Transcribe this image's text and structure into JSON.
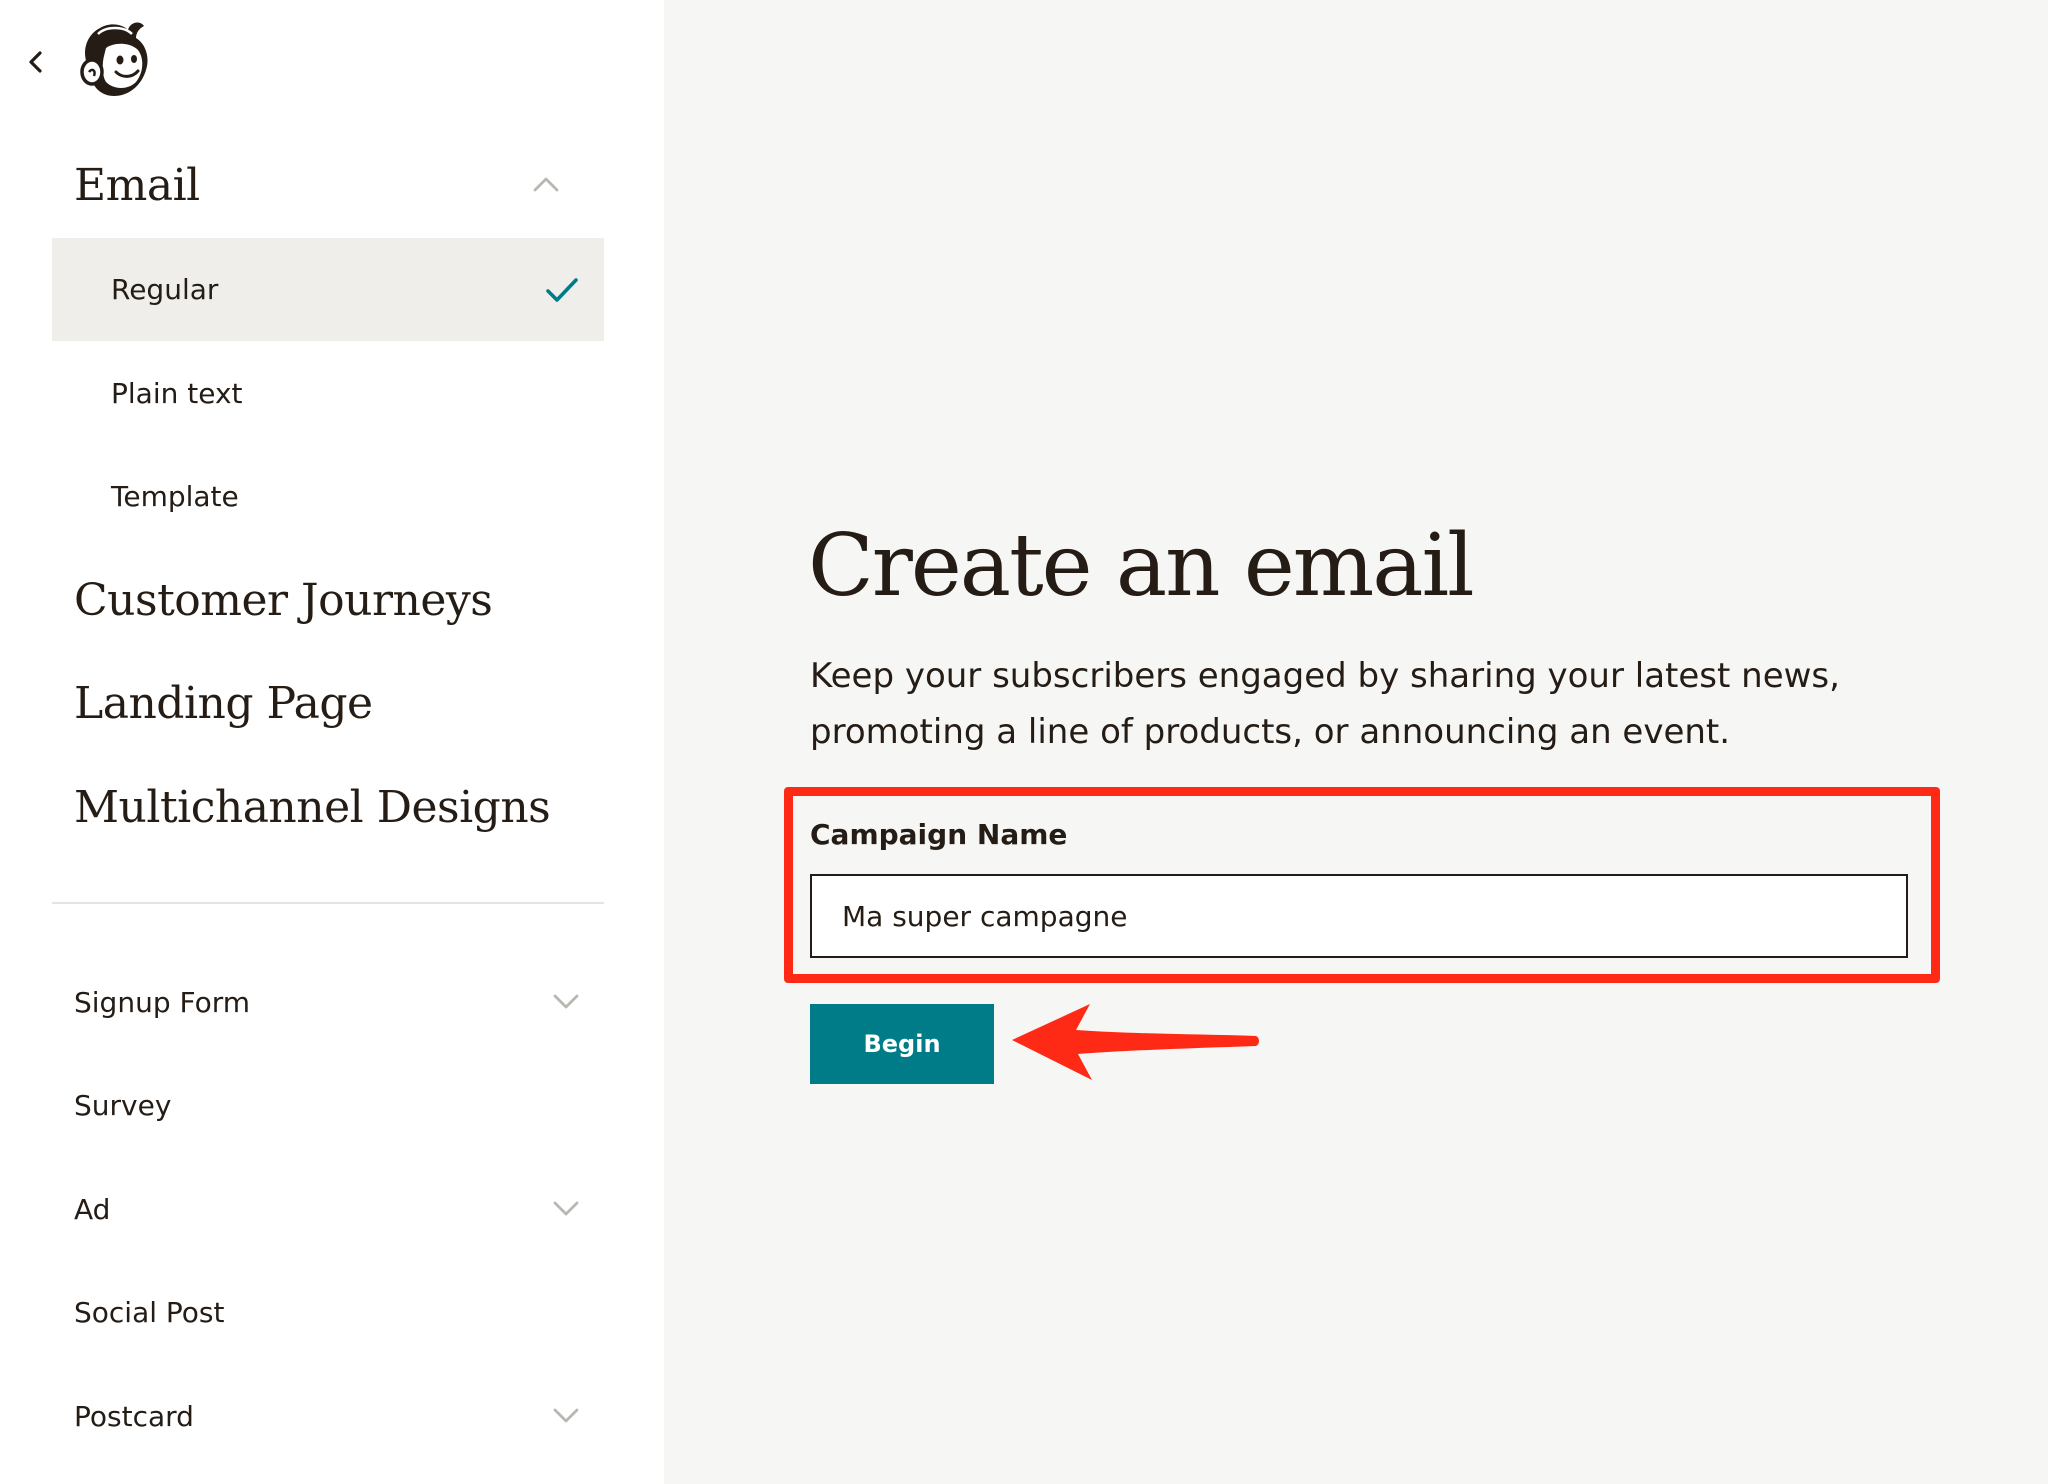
{
  "sidebar": {
    "back_icon": "chevron-left-icon",
    "logo_icon": "mailchimp-freddie-logo",
    "email_section": {
      "label": "Email",
      "icon": "chevron-up-icon",
      "items": [
        {
          "label": "Regular",
          "selected": true,
          "icon": "checkmark-icon"
        },
        {
          "label": "Plain text",
          "selected": false
        },
        {
          "label": "Template",
          "selected": false
        }
      ]
    },
    "sections": [
      {
        "label": "Customer Journeys"
      },
      {
        "label": "Landing Page"
      },
      {
        "label": "Multichannel Designs"
      }
    ],
    "lower_items": [
      {
        "label": "Signup Form",
        "icon": "chevron-down-icon"
      },
      {
        "label": "Survey"
      },
      {
        "label": "Ad",
        "icon": "chevron-down-icon"
      },
      {
        "label": "Social Post"
      },
      {
        "label": "Postcard",
        "icon": "chevron-down-icon"
      }
    ]
  },
  "main": {
    "title": "Create an email",
    "description": "Keep your subscribers engaged by sharing your latest news, promoting a line of products, or announcing an event.",
    "campaign_label": "Campaign Name",
    "campaign_value": "Ma super campagne",
    "begin_label": "Begin"
  },
  "colors": {
    "accent": "#007c89",
    "annotation": "#ff2a16",
    "selected_bg": "#efeeea",
    "main_bg": "#f6f6f4",
    "text": "#241c15"
  }
}
